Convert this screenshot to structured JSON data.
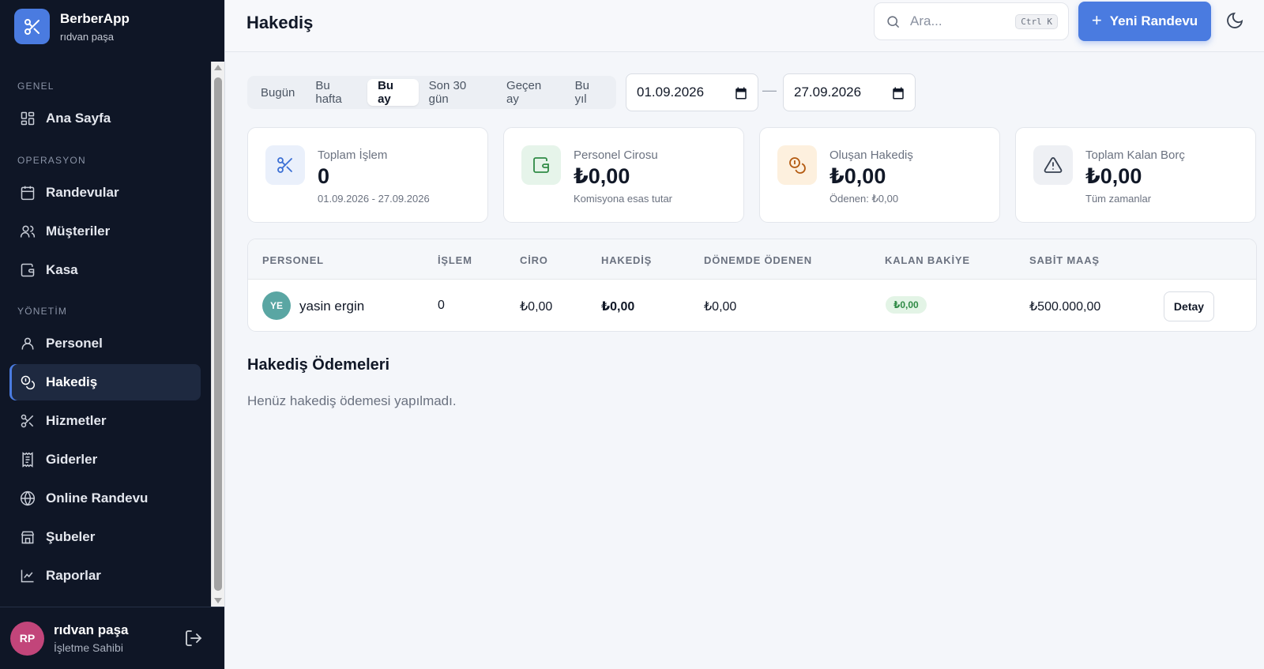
{
  "app": {
    "name": "BerberApp",
    "subtitle": "rıdvan paşa"
  },
  "sidebar": {
    "sections": {
      "genel": "GENEL",
      "operasyon": "OPERASYON",
      "yonetim": "YÖNETİM"
    },
    "items": [
      {
        "label": "Ana Sayfa",
        "icon": "grid-icon"
      },
      {
        "label": "Randevular",
        "icon": "calendar-icon"
      },
      {
        "label": "Müşteriler",
        "icon": "users-icon"
      },
      {
        "label": "Kasa",
        "icon": "wallet-icon"
      },
      {
        "label": "Personel",
        "icon": "user-icon"
      },
      {
        "label": "Hakediş",
        "icon": "coins-icon",
        "active": true
      },
      {
        "label": "Hizmetler",
        "icon": "scissors-icon"
      },
      {
        "label": "Giderler",
        "icon": "receipt-icon"
      },
      {
        "label": "Online Randevu",
        "icon": "globe-icon"
      },
      {
        "label": "Şubeler",
        "icon": "store-icon"
      },
      {
        "label": "Raporlar",
        "icon": "chart-icon"
      }
    ]
  },
  "user": {
    "initials": "RP",
    "name": "rıdvan paşa",
    "role": "İşletme Sahibi"
  },
  "header": {
    "title": "Hakediş",
    "search_placeholder": "Ara...",
    "search_shortcut": "Ctrl K",
    "new_button": "Yeni Randevu"
  },
  "filters": {
    "ranges": [
      "Bugün",
      "Bu hafta",
      "Bu ay",
      "Son 30 gün",
      "Geçen ay",
      "Bu yıl"
    ],
    "active_range": "Bu ay",
    "date_from": "01.09.2026",
    "date_to": "27.09.2026",
    "separator": "—"
  },
  "cards": [
    {
      "label": "Toplam İşlem",
      "value": "0",
      "sub": "01.09.2026 - 27.09.2026",
      "icon": "scissors-icon",
      "color": "#3b6fd4",
      "bg": "#eaf0fb"
    },
    {
      "label": "Personel Cirosu",
      "value": "₺0,00",
      "sub": "Komisyona esas tutar",
      "icon": "wallet-icon",
      "color": "#2f8a45",
      "bg": "#e6f4ea"
    },
    {
      "label": "Oluşan Hakediş",
      "value": "₺0,00",
      "sub": "Ödenen: ₺0,00",
      "icon": "coins-icon",
      "color": "#b45b12",
      "bg": "#fdf0de"
    },
    {
      "label": "Toplam Kalan Borç",
      "value": "₺0,00",
      "sub": "Tüm zamanlar",
      "icon": "alert-triangle-icon",
      "color": "#374151",
      "bg": "#eef0f4"
    }
  ],
  "table": {
    "headers": [
      "PERSONEL",
      "İŞLEM",
      "CİRO",
      "HAKEDİŞ",
      "DÖNEMDE ÖDENEN",
      "KALAN BAKİYE",
      "SABİT MAAŞ"
    ],
    "rows": [
      {
        "initials": "YE",
        "name": "yasin ergin",
        "islem": "0",
        "ciro": "₺0,00",
        "hakedis": "₺0,00",
        "odenen": "₺0,00",
        "kalan": "₺0,00",
        "maas": "₺500.000,00",
        "action": "Detay"
      }
    ]
  },
  "payments": {
    "title": "Hakediş Ödemeleri",
    "empty": "Henüz hakediş ödemesi yapılmadı."
  },
  "colors": {
    "accent": "#4a7be0",
    "sidebar_bg": "#0f1626",
    "success": "#2f8a45"
  }
}
